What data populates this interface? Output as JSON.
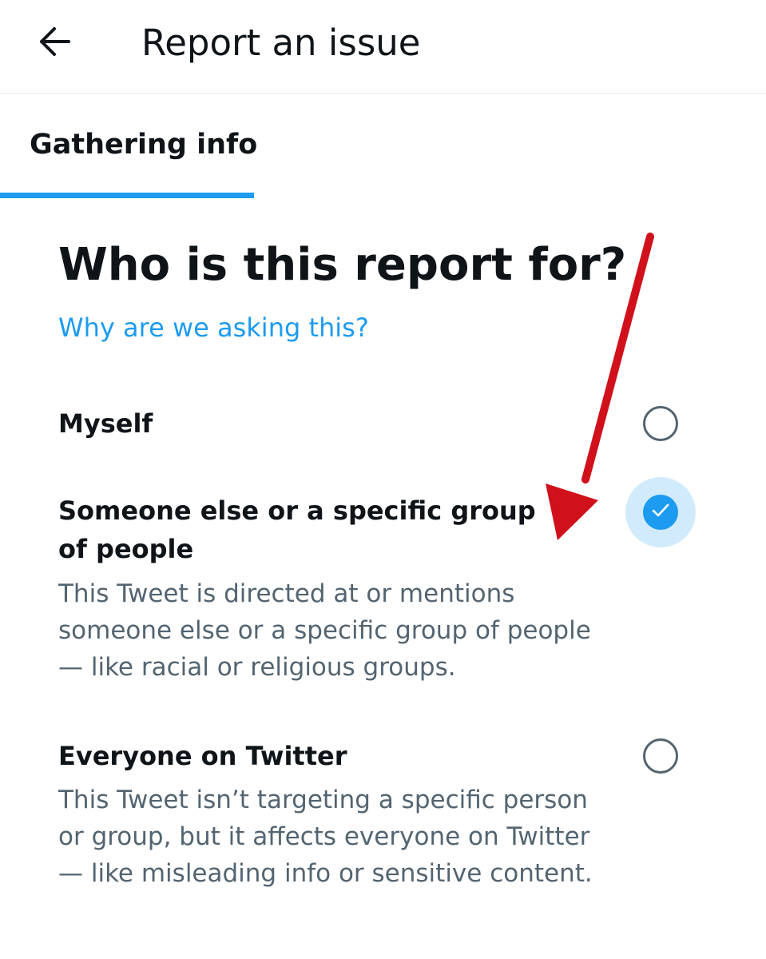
{
  "header": {
    "title": "Report an issue",
    "back_icon": "arrow-left-icon"
  },
  "tabs": [
    {
      "label": "Gathering info",
      "active": true
    }
  ],
  "question": {
    "title": "Who is this report for?",
    "help_link": "Why are we asking this?"
  },
  "options": [
    {
      "title": "Myself",
      "description": "",
      "selected": false
    },
    {
      "title": "Someone else or a specific group of people",
      "description": "This Tweet is directed at or mentions someone else or a specific group of people — like racial or religious groups.",
      "selected": true
    },
    {
      "title": "Everyone on Twitter",
      "description": "This Tweet isn’t targeting a specific person or group, but it affects everyone on Twitter — like misleading info or sensitive content.",
      "selected": false
    }
  ],
  "colors": {
    "accent": "#1d9bf0",
    "text_primary": "#0f1419",
    "text_secondary": "#536471",
    "annotation_arrow": "#d0111b"
  }
}
